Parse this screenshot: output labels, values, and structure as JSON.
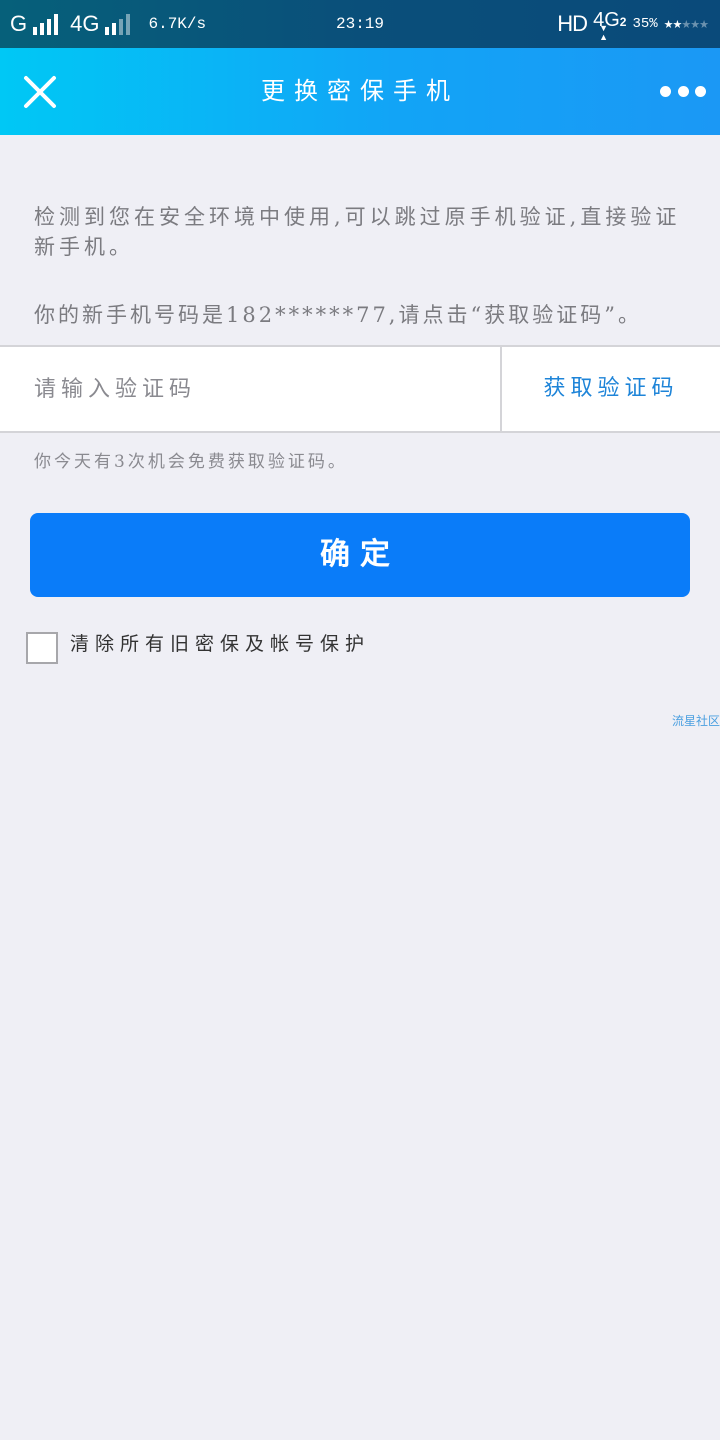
{
  "status_bar": {
    "carrier1": "G",
    "carrier2": "4G",
    "speed": "6.7K/s",
    "time": "23:19",
    "hd": "HD",
    "network": "4G",
    "network_sub": "2",
    "battery": "35%",
    "rating_on": "★★",
    "rating_off": "★★★"
  },
  "header": {
    "title": "更换密保手机",
    "close_icon": "close-icon",
    "more_icon": "more-icon"
  },
  "content": {
    "description": "检测到您在安全环境中使用,可以跳过原手机验证,直接验证新手机。",
    "phone_line": "你的新手机号码是182******77,请点击“获取验证码”。",
    "code_placeholder": "请输入验证码",
    "get_code_label": "获取验证码",
    "hint": "你今天有3次机会免费获取验证码。",
    "confirm_label": "确定",
    "checkbox_label": "清除所有旧密保及帐号保护"
  },
  "watermark": "流星社区",
  "colors": {
    "title_bar_start": "#00c8f5",
    "title_bar_end": "#1b98f5",
    "primary_button": "#0a7cf9",
    "link": "#1e84d8",
    "background": "#efeff5"
  }
}
